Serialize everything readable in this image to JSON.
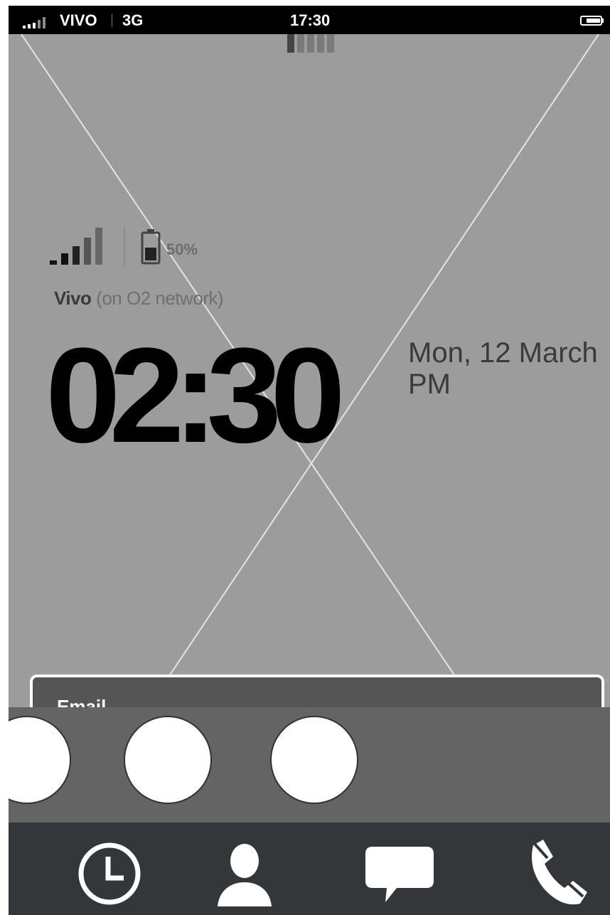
{
  "status_bar": {
    "carrier": "VIVO",
    "network": "3G",
    "time": "17:30"
  },
  "lock_screen": {
    "battery_percent": "50%",
    "carrier_name": "Vivo",
    "carrier_note": "(on O2 network)",
    "clock": "02:30",
    "date": "Mon, 12 March",
    "ampm": "PM",
    "image_placeholder": "placeholder-image"
  },
  "notification": {
    "label": "Email"
  },
  "dock": {
    "items": [
      "app-slot-1",
      "app-slot-2",
      "app-slot-3"
    ]
  },
  "nav_bar": {
    "items": [
      {
        "name": "recents",
        "icon": "clock-icon"
      },
      {
        "name": "contacts",
        "icon": "person-icon"
      },
      {
        "name": "messages",
        "icon": "chat-bubble-icon"
      },
      {
        "name": "phone",
        "icon": "phone-icon"
      }
    ]
  },
  "colors": {
    "background": "#9c9c9c",
    "status_bar": "#000000",
    "dock": "#646464",
    "nav_bar": "#34373a",
    "notification": "#555555"
  }
}
